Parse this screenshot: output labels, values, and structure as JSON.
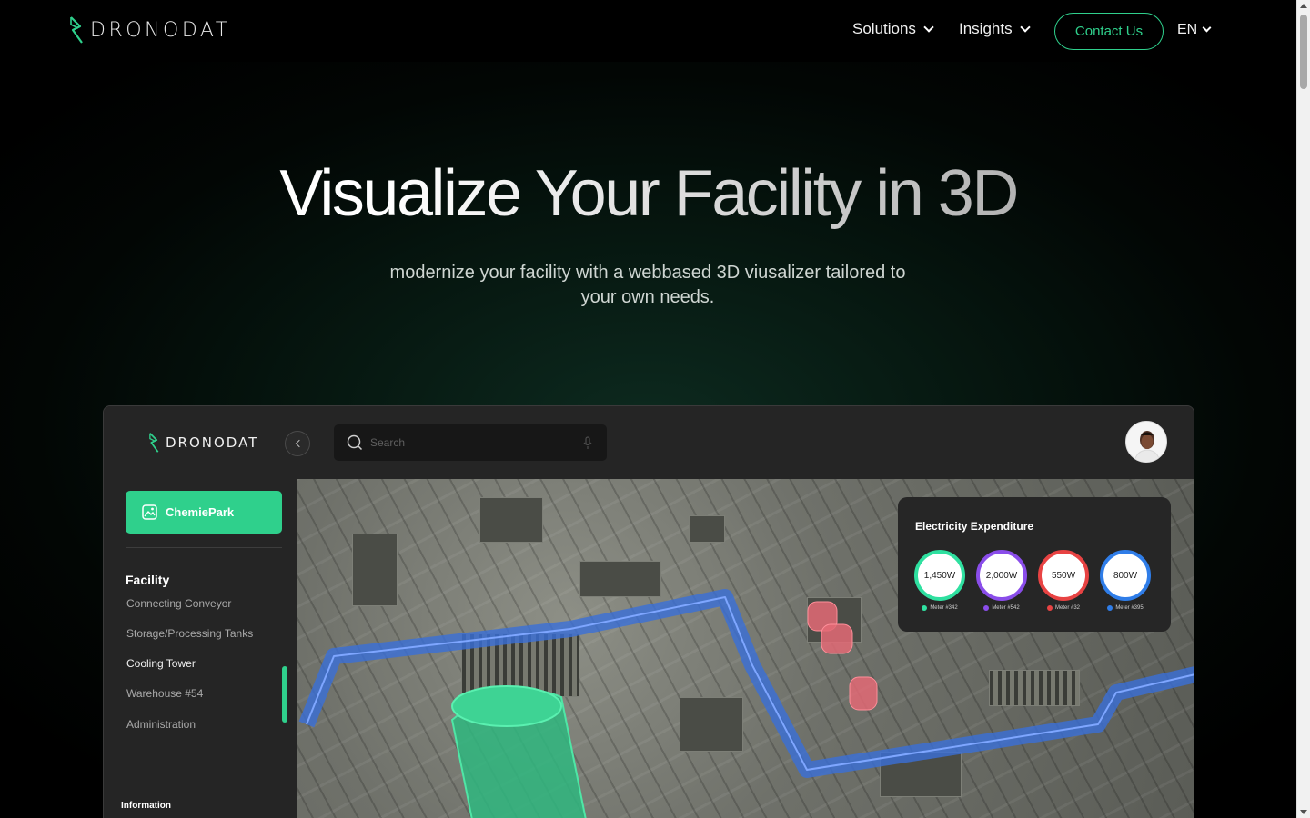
{
  "brand": {
    "name": "DRONODAT",
    "accent": "#2fd08c"
  },
  "nav": {
    "items": [
      {
        "label": "Solutions"
      },
      {
        "label": "Insights"
      }
    ],
    "contact_label": "Contact Us",
    "language": "EN"
  },
  "hero": {
    "title": "Visualize Your Facility in 3D",
    "subtitle": "modernize your facility with a webbased 3D viusalizer tailored to your own needs."
  },
  "dashboard": {
    "brand": "DRONODAT",
    "project_button": "ChemiePark",
    "search_placeholder": "Search",
    "facility": {
      "heading": "Facility",
      "items": [
        {
          "label": "Connecting Conveyor",
          "active": false
        },
        {
          "label": "Storage/Processing Tanks",
          "active": false
        },
        {
          "label": "Cooling Tower",
          "active": true
        },
        {
          "label": "Warehouse #54",
          "active": false
        },
        {
          "label": "Administration",
          "active": false
        }
      ]
    },
    "information_heading": "Information",
    "electricity": {
      "title": "Electricity Expenditure",
      "meters": [
        {
          "value": "1,450W",
          "label": "Meter #342",
          "color": "#2fe0a0"
        },
        {
          "value": "2,000W",
          "label": "Meter #542",
          "color": "#8a4dea"
        },
        {
          "value": "550W",
          "label": "Meter #32",
          "color": "#e84343"
        },
        {
          "value": "800W",
          "label": "Meter #395",
          "color": "#2f7de8"
        }
      ]
    }
  }
}
